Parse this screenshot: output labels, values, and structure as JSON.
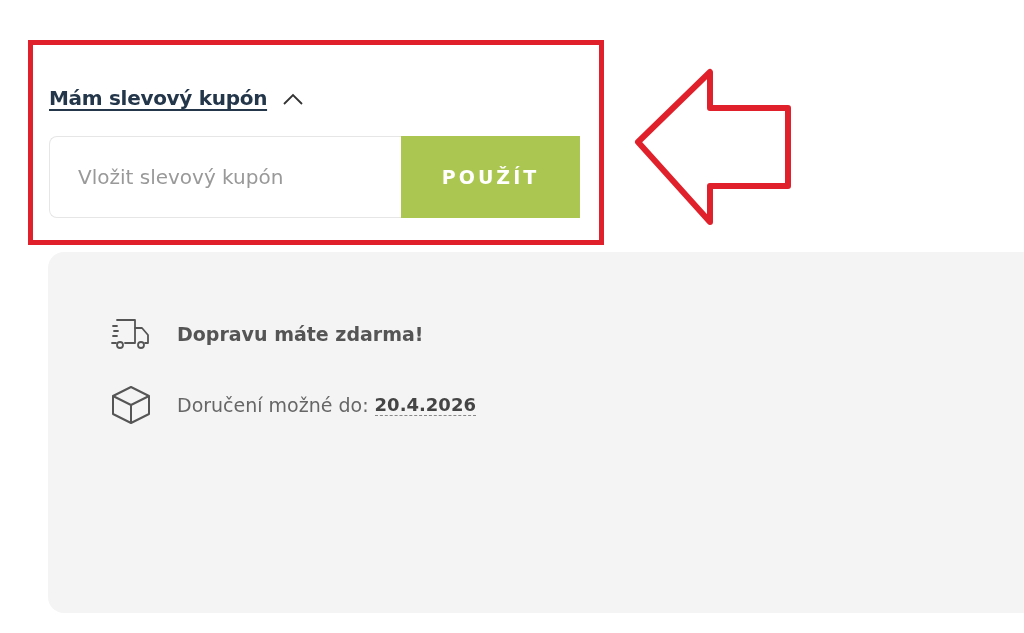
{
  "coupon": {
    "toggle_label": "Mám slevový kupón",
    "expanded": true,
    "placeholder": "Vložit slevový kupón",
    "apply_button": "POUŽÍT"
  },
  "delivery_info": {
    "free_shipping": "Dopravu máte zdarma!",
    "delivery_label": "Doručení možné do:",
    "delivery_date": "20.4.2026"
  }
}
